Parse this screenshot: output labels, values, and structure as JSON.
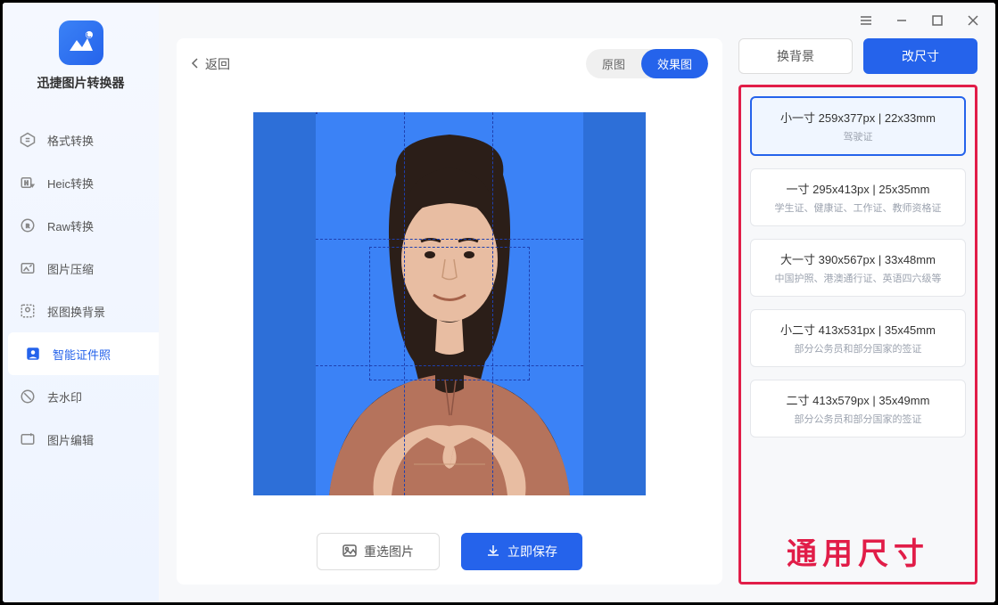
{
  "app": {
    "title": "迅捷图片转换器"
  },
  "sidebar": {
    "items": [
      {
        "label": "格式转换"
      },
      {
        "label": "Heic转换"
      },
      {
        "label": "Raw转换"
      },
      {
        "label": "图片压缩"
      },
      {
        "label": "抠图换背景"
      },
      {
        "label": "智能证件照"
      },
      {
        "label": "去水印"
      },
      {
        "label": "图片编辑"
      }
    ]
  },
  "preview": {
    "back": "返回",
    "toggle_original": "原图",
    "toggle_result": "效果图",
    "reselect": "重选图片",
    "save": "立即保存"
  },
  "right": {
    "tab_bg": "换背景",
    "tab_size": "改尺寸",
    "sizes": [
      {
        "title": "小一寸 259x377px | 22x33mm",
        "desc": "驾驶证"
      },
      {
        "title": "一寸 295x413px | 25x35mm",
        "desc": "学生证、健康证、工作证、教师资格证"
      },
      {
        "title": "大一寸 390x567px | 33x48mm",
        "desc": "中国护照、港澳通行证、英语四六级等"
      },
      {
        "title": "小二寸 413x531px | 35x45mm",
        "desc": "部分公务员和部分国家的签证"
      },
      {
        "title": "二寸 413x579px | 35x49mm",
        "desc": "部分公务员和部分国家的签证"
      }
    ],
    "big_label": "通用尺寸"
  }
}
